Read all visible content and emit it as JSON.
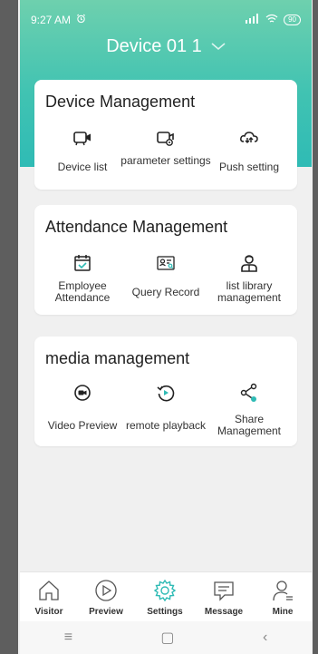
{
  "status_bar": {
    "time": "9:27 AM",
    "signal": "᯾ıll",
    "battery": "90"
  },
  "header": {
    "title": "Device 01 1"
  },
  "cards": [
    {
      "title": "Device Management",
      "items": [
        {
          "label": "Device list",
          "icon": "camera-icon"
        },
        {
          "label": "parameter settings",
          "icon": "camera-gear-icon"
        },
        {
          "label": "Push setting",
          "icon": "cloud-push-icon"
        }
      ]
    },
    {
      "title": "Attendance Management",
      "items": [
        {
          "label": "Employee Attendance",
          "icon": "calendar-check-icon"
        },
        {
          "label": "Query Record",
          "icon": "id-card-search-icon"
        },
        {
          "label": "list library management",
          "icon": "person-list-icon"
        }
      ]
    },
    {
      "title": "media management",
      "items": [
        {
          "label": "Video Preview",
          "icon": "video-preview-icon"
        },
        {
          "label": "remote playback",
          "icon": "playback-icon"
        },
        {
          "label": "Share Management",
          "icon": "share-icon"
        }
      ]
    }
  ],
  "bottom_nav": [
    {
      "label": "Visitor",
      "icon": "home-icon"
    },
    {
      "label": "Preview",
      "icon": "play-circle-icon"
    },
    {
      "label": "Settings",
      "icon": "gear-icon",
      "active": true
    },
    {
      "label": "Message",
      "icon": "message-icon"
    },
    {
      "label": "Mine",
      "icon": "person-icon"
    }
  ],
  "system_nav": {
    "menu": "≡",
    "home": "▢",
    "back": "‹"
  },
  "colors": {
    "accent": "#2fbbb5",
    "active_nav": "#2fbbb5",
    "icon": "#222222"
  }
}
